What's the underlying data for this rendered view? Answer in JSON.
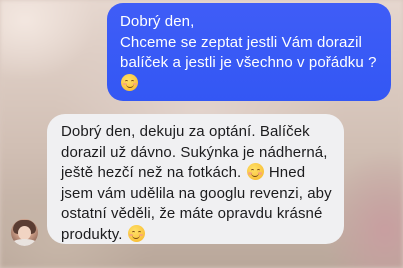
{
  "thread": {
    "outgoing": {
      "lines": [
        "Dobrý den,",
        "Chceme se zeptat jestli Vám dorazil",
        "balíček a jestli je všechno v pořádku ?"
      ],
      "emoji": "smiling-blush-emoji"
    },
    "incoming": {
      "lines": [
        "Dobrý den, dekuju za optání. Balíček",
        "dorazil už dávno. Sukýnka je nádherná,",
        "ještě hezčí než na fotkách.",
        "Hned",
        "jsem vám udělila na googlu revenzi, aby",
        "ostatní věděli, že máte opravdu krásné",
        "produkty."
      ],
      "emoji": "smiling-blush-emoji"
    },
    "colors": {
      "outgoing_bubble": "#3b5cf6",
      "outgoing_text": "#ffffff",
      "incoming_bubble": "#f0f0f2",
      "incoming_text": "#1c1c1e"
    }
  }
}
